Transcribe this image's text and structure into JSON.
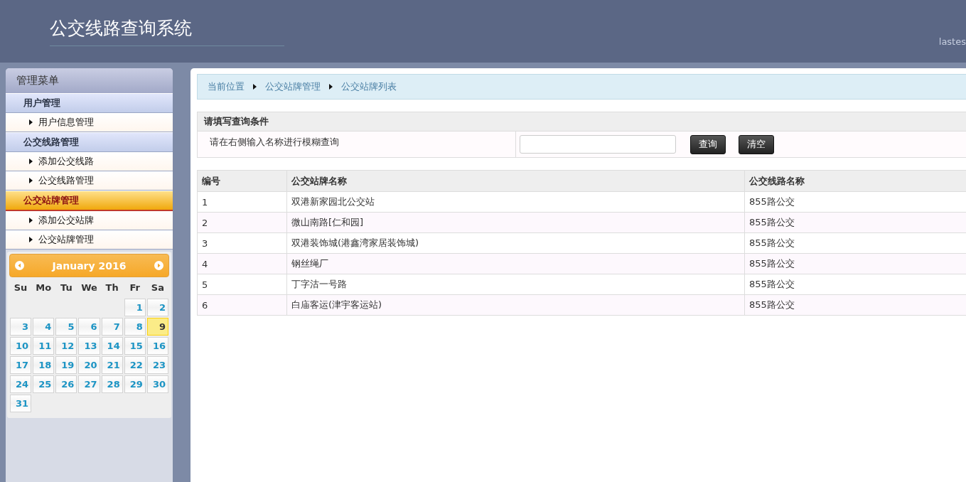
{
  "header": {
    "title": "公交线路查询系统",
    "user_text": "lastes"
  },
  "sidebar": {
    "title": "管理菜单",
    "groups": [
      {
        "title": "用户管理",
        "selected": false,
        "items": [
          "用户信息管理"
        ]
      },
      {
        "title": "公交线路管理",
        "selected": false,
        "items": [
          "添加公交线路",
          "公交线路管理"
        ]
      },
      {
        "title": "公交站牌管理",
        "selected": true,
        "items": [
          "添加公交站牌",
          "公交站牌管理"
        ]
      }
    ]
  },
  "calendar": {
    "month": "January 2016",
    "weekdays": [
      "Su",
      "Mo",
      "Tu",
      "We",
      "Th",
      "Fr",
      "Sa"
    ],
    "weeks": [
      [
        {
          "day": "1",
          "selected": false
        },
        {
          "day": "2",
          "selected": false
        }
      ],
      [
        {
          "day": "3",
          "selected": false
        },
        {
          "day": "4",
          "selected": false
        },
        {
          "day": "5",
          "selected": false
        },
        {
          "day": "6",
          "selected": false
        },
        {
          "day": "7",
          "selected": false
        },
        {
          "day": "8",
          "selected": false
        },
        {
          "day": "9",
          "selected": true
        }
      ],
      [
        {
          "day": "10",
          "selected": false
        },
        {
          "day": "11",
          "selected": false
        },
        {
          "day": "12",
          "selected": false
        },
        {
          "day": "13",
          "selected": false
        },
        {
          "day": "14",
          "selected": false
        },
        {
          "day": "15",
          "selected": false
        },
        {
          "day": "16",
          "selected": false
        }
      ],
      [
        {
          "day": "17",
          "selected": false
        },
        {
          "day": "18",
          "selected": false
        },
        {
          "day": "19",
          "selected": false
        },
        {
          "day": "20",
          "selected": false
        },
        {
          "day": "21",
          "selected": false
        },
        {
          "day": "22",
          "selected": false
        },
        {
          "day": "23",
          "selected": false
        }
      ],
      [
        {
          "day": "24",
          "selected": false
        },
        {
          "day": "25",
          "selected": false
        },
        {
          "day": "26",
          "selected": false
        },
        {
          "day": "27",
          "selected": false
        },
        {
          "day": "28",
          "selected": false
        },
        {
          "day": "29",
          "selected": false
        },
        {
          "day": "30",
          "selected": false
        }
      ],
      [
        {
          "day": "31",
          "selected": false
        }
      ]
    ]
  },
  "breadcrumb": [
    "当前位置",
    "公交站牌管理",
    "公交站牌列表"
  ],
  "query": {
    "title": "请填写查询条件",
    "hint": "请在右侧输入名称进行模糊查询",
    "buttons": [
      "查询",
      "清空"
    ]
  },
  "table": {
    "columns": [
      "编号",
      "公交站牌名称",
      "公交线路名称"
    ],
    "rows": [
      [
        "1",
        "双港新家园北公交站",
        "855路公交"
      ],
      [
        "2",
        "微山南路[仁和园]",
        "855路公交"
      ],
      [
        "3",
        "双港装饰城(港鑫湾家居装饰城)",
        "855路公交"
      ],
      [
        "4",
        "钢丝绳厂",
        "855路公交"
      ],
      [
        "5",
        "丁字沽一号路",
        "855路公交"
      ],
      [
        "6",
        "白庙客运(津宇客运站)",
        "855路公交"
      ]
    ]
  }
}
